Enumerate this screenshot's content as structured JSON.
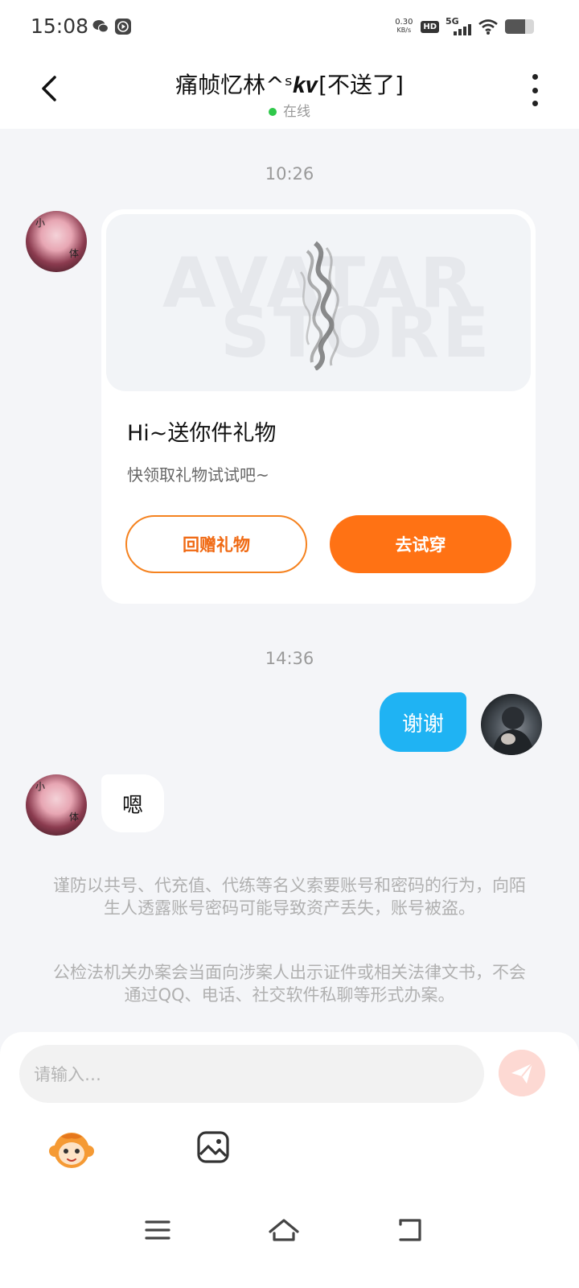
{
  "status_bar": {
    "time": "15:08",
    "net_speed_value": "0.30",
    "net_speed_unit": "KB/s",
    "hd": "HD",
    "network": "5G",
    "icons": [
      "wechat-icon",
      "video-app-icon",
      "hd-voice-icon",
      "signal-icon",
      "wifi-icon",
      "battery-icon"
    ],
    "battery_level": 0.7
  },
  "header": {
    "title": "痛帧忆林^ˢ𝒌𝒗[不送了]",
    "status": "在线",
    "online_color": "#2fc84a"
  },
  "messages": {
    "time_1": "10:26",
    "gift_card": {
      "watermark_line1": "AVATAR",
      "watermark_line2": "STORE",
      "title": "Hi~送你件礼物",
      "subtitle": "快领取礼物试试吧~",
      "return_gift_label": "回赠礼物",
      "try_on_label": "去试穿"
    },
    "time_2": "14:36",
    "outgoing_text": "谢谢",
    "incoming_text": "嗯",
    "avatar_chars": [
      "小",
      "体"
    ]
  },
  "notices": {
    "fraud_warning": "谨防以共号、代充值、代练等名义索要账号和密码的行为，向陌生人透露账号密码可能导致资产丢失，账号被盗。",
    "police_notice": "公检法机关办案会当面向涉案人出示证件或相关法律文书，不会通过QQ、电话、社交软件私聊等形式办案。"
  },
  "input": {
    "placeholder": "请输入…"
  },
  "colors": {
    "accent_orange": "#ff7214",
    "bubble_blue": "#1fb3f3",
    "background": "#f4f5f8"
  }
}
